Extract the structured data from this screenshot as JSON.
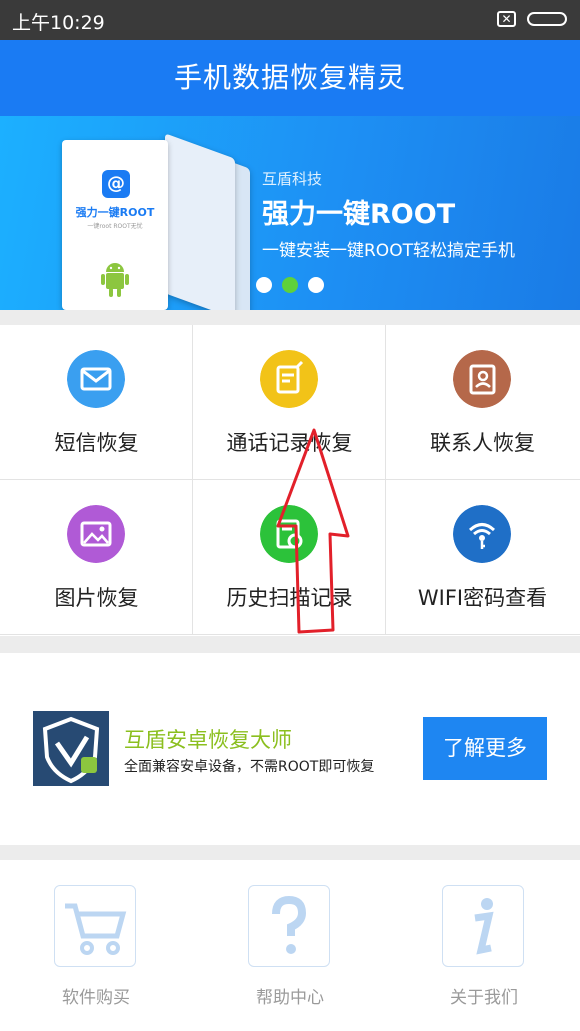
{
  "status_bar": {
    "time": "上午10:29"
  },
  "header": {
    "title": "手机数据恢复精灵"
  },
  "banner": {
    "phone_title": "强力一键ROOT",
    "phone_sub": "一键root ROOT无忧",
    "brand": "互盾科技",
    "headline": "强力一键ROOT",
    "subline": "一键安装一键ROOT轻松搞定手机",
    "active_dot": 2,
    "dot_count": 3
  },
  "features": [
    {
      "label": "短信恢复",
      "icon": "envelope-icon",
      "color": "#3a9ff0"
    },
    {
      "label": "通话记录恢复",
      "icon": "call-log-icon",
      "color": "#f2c318"
    },
    {
      "label": "联系人恢复",
      "icon": "contacts-icon",
      "color": "#b5684a"
    },
    {
      "label": "图片恢复",
      "icon": "image-icon",
      "color": "#b05ad6"
    },
    {
      "label": "历史扫描记录",
      "icon": "scan-history-icon",
      "color": "#2cc23a"
    },
    {
      "label": "WIFI密码查看",
      "icon": "wifi-key-icon",
      "color": "#1f6fc7"
    }
  ],
  "promo": {
    "title": "互盾安卓恢复大师",
    "description": "全面兼容安卓设备，不需ROOT即可恢复",
    "button": "了解更多"
  },
  "footer": [
    {
      "label": "软件购买",
      "icon": "cart-icon"
    },
    {
      "label": "帮助中心",
      "icon": "help-icon"
    },
    {
      "label": "关于我们",
      "icon": "info-icon"
    }
  ],
  "colors": {
    "title_bar": "#1a7bf3",
    "button": "#1e86f2",
    "promo_title": "#8bbf1f",
    "annotation_arrow": "#e2202a"
  }
}
